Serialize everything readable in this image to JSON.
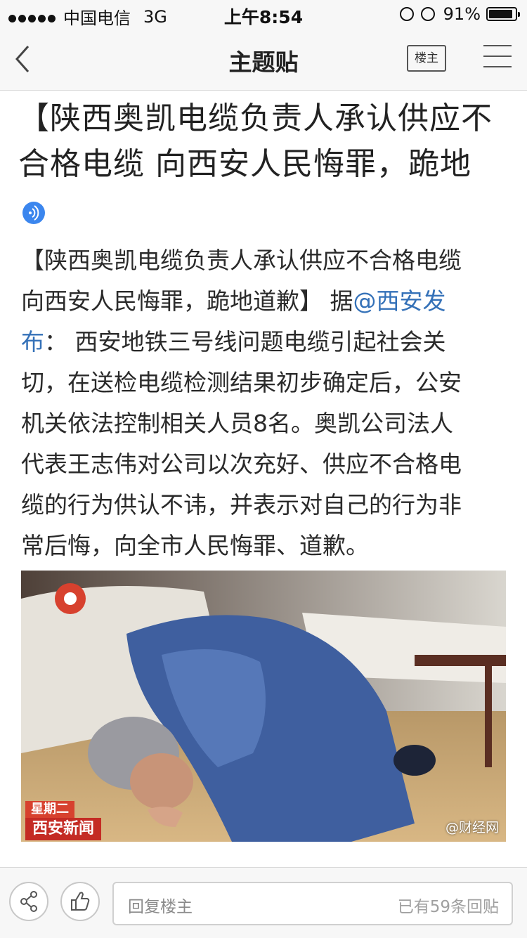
{
  "status_bar": {
    "carrier": "中国电信",
    "network": "3G",
    "time": "上午8:54",
    "battery_text": "91%",
    "battery_level": 0.91
  },
  "nav": {
    "title": "主题贴",
    "op_button_label": "楼主",
    "back_icon": "chevron-left-icon",
    "menu_icon": "hamburger-menu-icon"
  },
  "post": {
    "title": " 【陕西奥凯电缆负责人承认供应不\n合格电缆 向西安人民悔罪，跪地",
    "body": {
      "line1": "【陕西奥凯电缆负责人承认供应不合格电缆",
      "line2_prefix": " 向西安人民悔罪，跪地道歉】 据",
      "link_part1": "@西安发",
      "link_part2": "布",
      "line3_rest": "： 西安地铁三号线问题电缆引起社会关",
      "line4": "切，在送检电缆检测结果初步确定后，公安",
      "line5": "机关依法控制相关人员8名。奥凯公司法人",
      "line6": "代表王志伟对公司以次充好、供应不合格电",
      "line7": "缆的行为供认不讳，并表示对自己的行为非",
      "line8": "常后悔，向全市人民悔罪、道歉。"
    },
    "image": {
      "caption_top": "星期二",
      "caption_bottom": "西安新闻",
      "watermark": "@财经网"
    }
  },
  "bottom_bar": {
    "reply_placeholder": "回复楼主",
    "reply_count": "已有59条回贴"
  },
  "colors": {
    "link": "#3471b8",
    "audio_icon": "#3b86ee",
    "bar_background": "#f7f7f7"
  }
}
